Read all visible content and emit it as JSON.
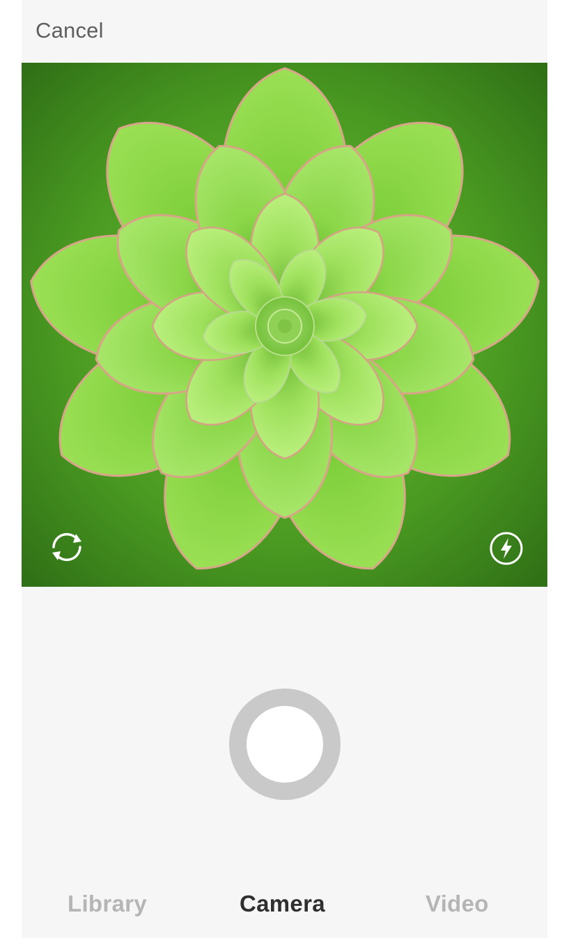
{
  "header": {
    "cancel_label": "Cancel"
  },
  "viewfinder": {
    "subject": "green succulent rosette",
    "flip_icon": "camera-flip-icon",
    "flash_icon": "flash-icon"
  },
  "shutter": {
    "icon": "shutter-button"
  },
  "tabs": [
    {
      "label": "Library",
      "active": false
    },
    {
      "label": "Camera",
      "active": true
    },
    {
      "label": "Video",
      "active": false
    }
  ],
  "colors": {
    "background": "#f6f6f6",
    "active_tab": "#2f2f2f",
    "inactive_tab": "#b5b5b5",
    "shutter_ring": "#c9c9c9"
  }
}
